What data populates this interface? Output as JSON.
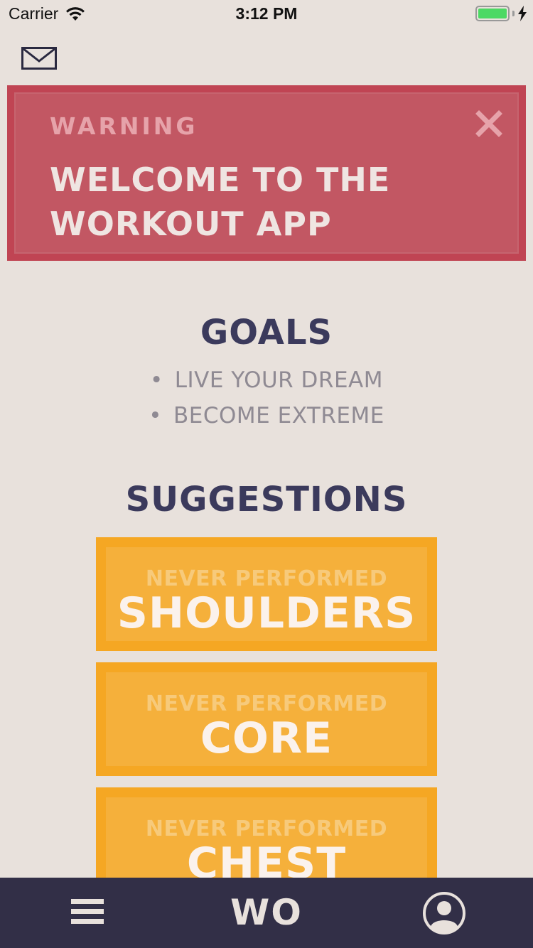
{
  "status_bar": {
    "carrier": "Carrier",
    "time": "3:12 PM"
  },
  "warning": {
    "label": "WARNING",
    "title_line1": "WELCOME TO THE",
    "title_line2": "WORKOUT APP"
  },
  "goals": {
    "title": "GOALS",
    "items": [
      {
        "bullet": "•",
        "text": "LIVE YOUR DREAM"
      },
      {
        "bullet": "•",
        "text": "BECOME EXTREME"
      }
    ]
  },
  "suggestions": {
    "title": "SUGGESTIONS",
    "cards": [
      {
        "subtitle": "NEVER PERFORMED",
        "name": "SHOULDERS"
      },
      {
        "subtitle": "NEVER PERFORMED",
        "name": "CORE"
      },
      {
        "subtitle": "NEVER PERFORMED",
        "name": "CHEST"
      }
    ]
  },
  "tabbar": {
    "logo": "WO"
  },
  "colors": {
    "background": "#e8e1dc",
    "warning": "#c25763",
    "card": "#f5a723",
    "navy": "#3b3a5c",
    "tabbar": "#322f47"
  },
  "icons": {
    "mail": "mail-icon",
    "close": "close-icon",
    "menu": "menu-icon",
    "profile": "profile-icon",
    "wifi": "wifi-icon",
    "battery": "battery-icon",
    "charging": "charging-icon"
  }
}
